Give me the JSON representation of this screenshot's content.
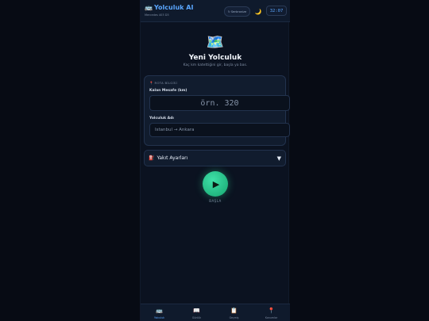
{
  "header": {
    "icon": "🚌",
    "title": "Yolculuk AI",
    "subtitle": "Mercedes 403 D3",
    "sync_label": "Senkronize",
    "sync_icon": "refresh-icon",
    "theme_icon": "🌙",
    "clock": "32:07"
  },
  "hero": {
    "icon": "🗺️",
    "title": "Yeni Yolculuk",
    "subtitle": "Kaç km katettiğini gir, başla ya bas."
  },
  "trip_card": {
    "header_icon": "📍",
    "header": "ROTA BİLGİSİ",
    "distance_label": "Kalan Mesafe (km)",
    "distance_placeholder": "örn. 320",
    "name_label": "Yolculuk Adı",
    "name_placeholder": "İstanbul → Ankara"
  },
  "fuel": {
    "icon": "⛽",
    "label": "Yakıt Ayarları",
    "chevron": "▼"
  },
  "start": {
    "icon": "▶",
    "label": "BAŞLA"
  },
  "nav": {
    "items": [
      {
        "icon": "🚌",
        "label": "Yolculuk",
        "active": true
      },
      {
        "icon": "📖",
        "label": "Günlük"
      },
      {
        "icon": "📋",
        "label": "Geçmiş"
      },
      {
        "icon": "📍",
        "label": "Konumlar"
      }
    ]
  },
  "colors": {
    "background": "#070b14",
    "accent": "#5aa6ff",
    "start_button": "#2bc48a"
  }
}
